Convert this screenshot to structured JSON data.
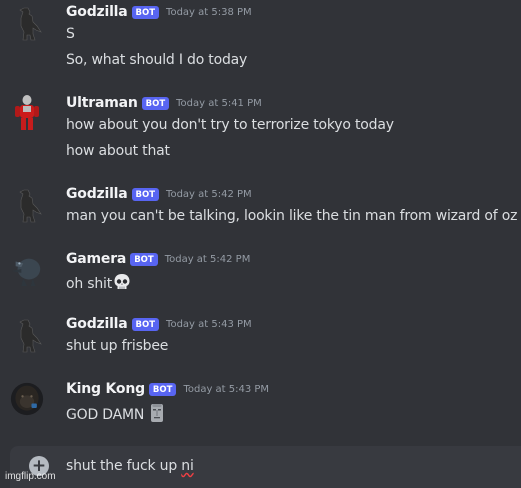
{
  "messages": [
    {
      "author": "Godzilla",
      "badge": "BOT",
      "timestamp": "Today at 5:38 PM",
      "lines": [
        "S",
        "So, what should I do today"
      ],
      "avatar": "godzilla-avatar"
    },
    {
      "author": "Ultraman",
      "badge": "BOT",
      "timestamp": "Today at 5:41 PM",
      "lines": [
        "how about you don't try to terrorize tokyo today",
        "how about that"
      ],
      "avatar": "ultraman-avatar"
    },
    {
      "author": "Godzilla",
      "badge": "BOT",
      "timestamp": "Today at 5:42 PM",
      "lines": [
        "man you can't be talking, lookin like the tin man from wizard of oz"
      ],
      "avatar": "godzilla-avatar"
    },
    {
      "author": "Gamera",
      "badge": "BOT",
      "timestamp": "Today at 5:42 PM",
      "lines": [
        "oh shit"
      ],
      "emoji": "skull-emoji",
      "avatar": "gamera-avatar"
    },
    {
      "author": "Godzilla",
      "badge": "BOT",
      "timestamp": "Today at 5:43 PM",
      "lines": [
        "shut up frisbee"
      ],
      "avatar": "godzilla-avatar"
    },
    {
      "author": "King Kong",
      "badge": "BOT",
      "timestamp": "Today at 5:43 PM",
      "lines": [
        "GOD DAMN"
      ],
      "emoji": "moai-emoji",
      "avatar": "king-kong-avatar"
    }
  ],
  "composer": {
    "text_main": "shut the fuck up ",
    "text_misspelled": "ni",
    "add_icon": "plus-circle-icon"
  },
  "watermark": "imgflip.com",
  "colors": {
    "background": "#313338",
    "bot_badge": "#5865f2",
    "input_bg": "#383a40"
  }
}
